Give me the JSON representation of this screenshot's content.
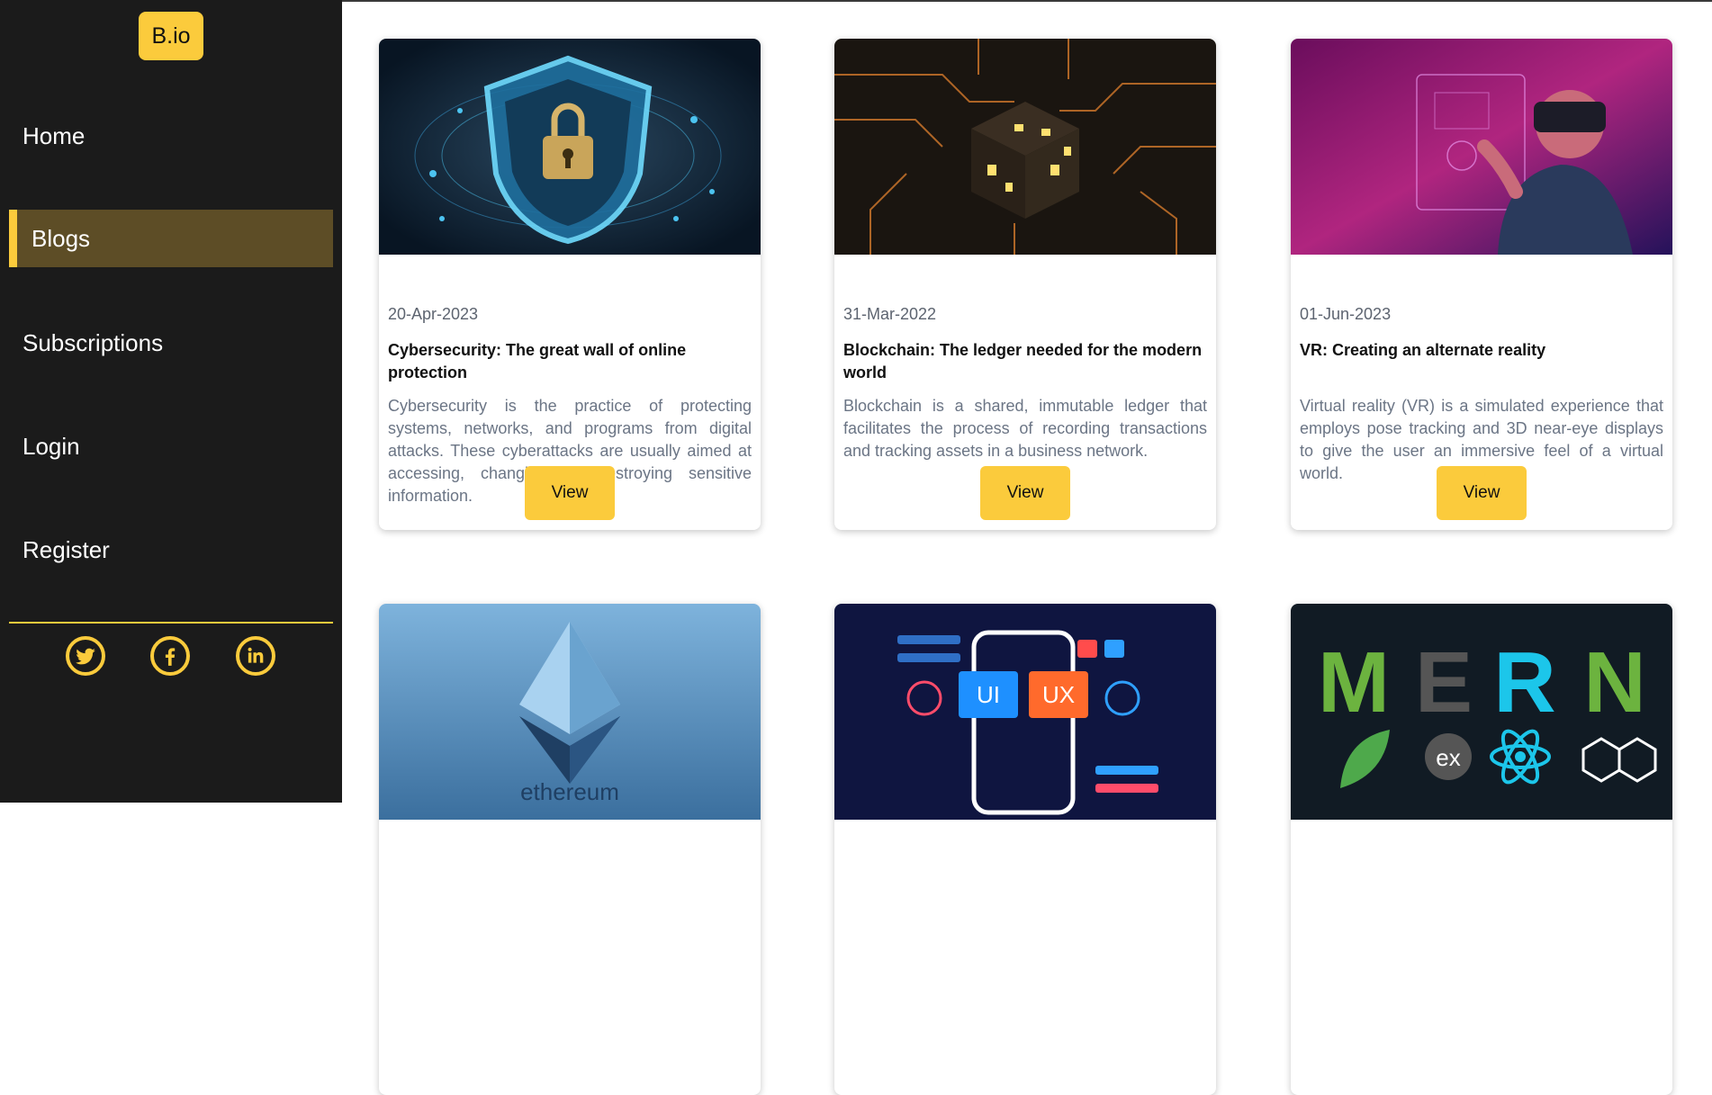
{
  "brand": {
    "logo_text": "B.io",
    "accent": "#fbcb3c"
  },
  "sidebar": {
    "items": [
      {
        "label": "Home"
      },
      {
        "label": "Blogs",
        "active": true
      },
      {
        "label": "Subscriptions"
      },
      {
        "label": "Login"
      },
      {
        "label": "Register"
      }
    ],
    "social": [
      "twitter-icon",
      "facebook-icon",
      "linkedin-icon"
    ]
  },
  "posts": [
    {
      "date": "20-Apr-2023",
      "title": "Cybersecurity: The great wall of online protection",
      "description": "Cybersecurity is the practice of protecting systems, networks, and programs from digital attacks. These cyberattacks are usually aimed at accessing, changing, or destroying sensitive information.",
      "button": "View"
    },
    {
      "date": "31-Mar-2022",
      "title": "Blockchain: The ledger needed for the modern world",
      "description": "Blockchain is a shared, immutable ledger that facilitates the process of recording transactions and tracking assets in a business network.",
      "button": "View"
    },
    {
      "date": "01-Jun-2023",
      "title": "VR: Creating an alternate reality",
      "description": "Virtual reality (VR) is a simulated experience that employs pose tracking and 3D near-eye displays to give the user an immersive feel of a virtual world.",
      "button": "View"
    },
    {
      "image_text": "ethereum"
    },
    {
      "image_text": [
        "UI",
        "UX"
      ]
    },
    {
      "image_text": [
        "M",
        "E",
        "R",
        "N",
        "ex"
      ]
    }
  ]
}
